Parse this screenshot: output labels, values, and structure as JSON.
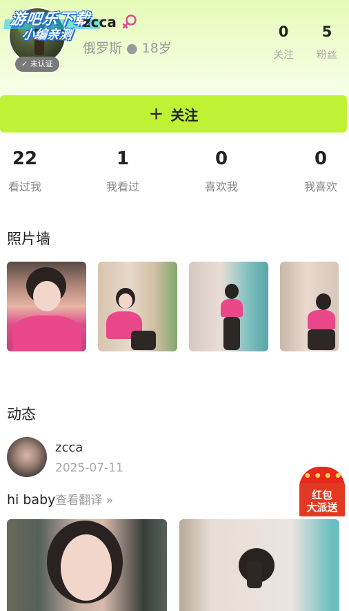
{
  "profile": {
    "watermark_line1": "游吧乐下载",
    "watermark_line2": "小编亲测",
    "verify_badge": "✓ 未认证",
    "username": "zcca",
    "gender": "female-icon",
    "location_age": "俄罗斯 ● 18岁",
    "following_count": "0",
    "following_label": "关注",
    "fans_count": "5",
    "fans_label": "粉丝",
    "gender_color": "#e0409a"
  },
  "follow_button": {
    "icon": "plus-icon",
    "label": "关注",
    "color": "#bff234"
  },
  "stats": [
    {
      "num": "22",
      "label": "看过我"
    },
    {
      "num": "1",
      "label": "我看过"
    },
    {
      "num": "0",
      "label": "喜欢我"
    },
    {
      "num": "0",
      "label": "我喜欢"
    }
  ],
  "photo_wall": {
    "title": "照片墙"
  },
  "feed": {
    "title": "动态",
    "post": {
      "username": "zcca",
      "date": "2025-07-11",
      "text": "hi baby",
      "translate": "查看翻译 »"
    }
  },
  "red_envelope": {
    "line1": "红包",
    "line2": "大派送",
    "color": "#e8271d"
  }
}
